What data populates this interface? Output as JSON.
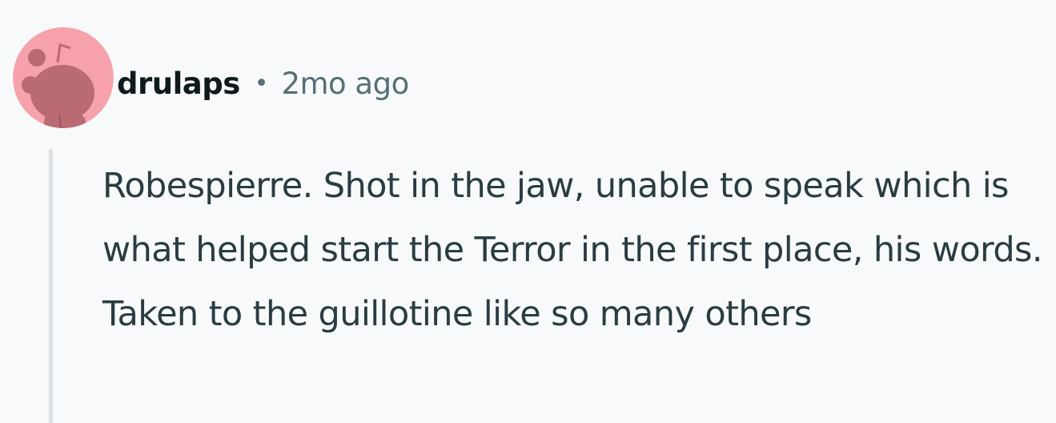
{
  "comment": {
    "author": {
      "username": "drulaps",
      "avatar_icon": "reddit-snoo-avatar-icon",
      "avatar_bg_color": "#f7a1aa",
      "avatar_figure_color": "#b96b71"
    },
    "separator": "•",
    "timestamp": "2mo ago",
    "body": "Robespierre. Shot in the jaw, unable to speak which is what helped start the Terror in the first place, his words. Taken to the guillotine like so many others"
  }
}
